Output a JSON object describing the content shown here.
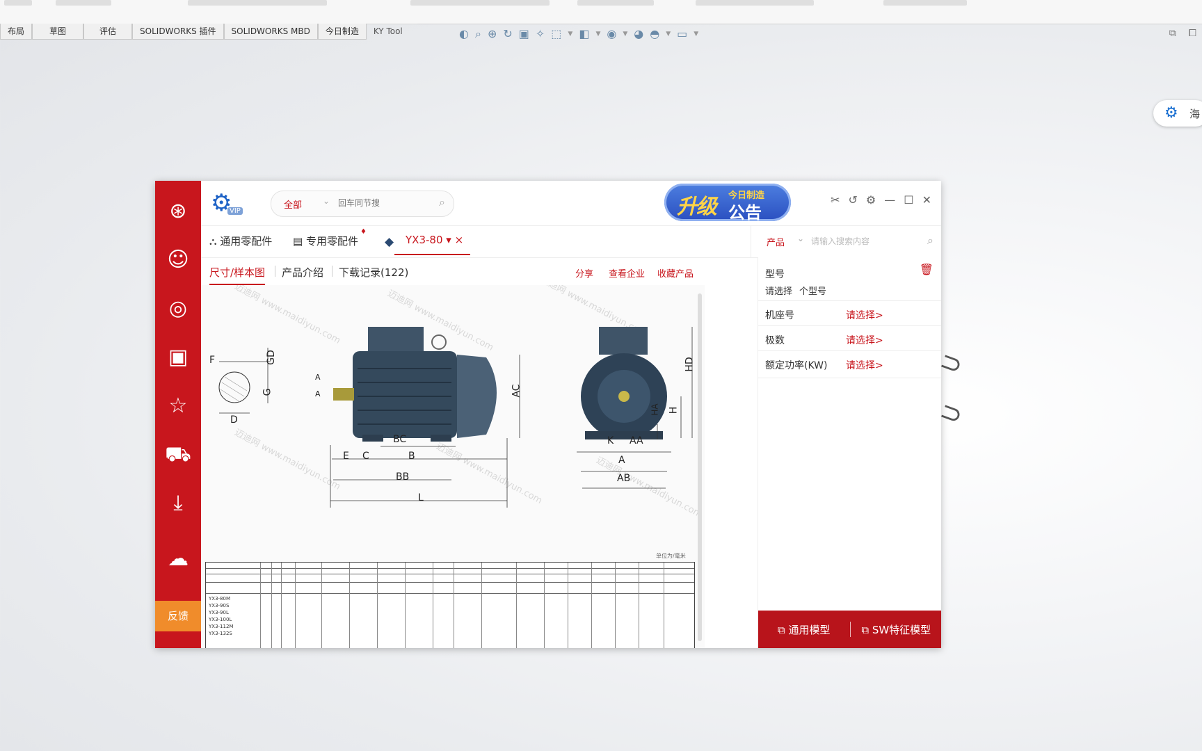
{
  "sw": {
    "tabs": [
      "布局",
      "草图",
      "评估",
      "SOLIDWORKS 插件",
      "SOLIDWORKS MBD",
      "今日制造",
      "KY Tool"
    ]
  },
  "side_pill": {
    "text": "海"
  },
  "app": {
    "header": {
      "vip": "VIP",
      "search_scope": "全部",
      "search_placeholder": "回车同节搜",
      "banner_main": "升级",
      "banner_sub": "今日制造",
      "banner_sub2": "公告"
    },
    "tabs": {
      "general": "通用零配件",
      "special": "专用零配件",
      "current": "YX3-80",
      "current_caret": "▾",
      "close": "×"
    },
    "right_search": {
      "scope": "产品",
      "placeholder": "请输入搜索内容"
    },
    "subtabs": {
      "dims": "尺寸/样本图",
      "intro": "产品介绍",
      "downloads": "下载记录(122)"
    },
    "actions": {
      "share": "分享",
      "company": "查看企业",
      "favorite": "收藏产品"
    },
    "drawing": {
      "labels": [
        "F",
        "GD",
        "G",
        "D",
        "A",
        "A",
        "AC",
        "BC",
        "E",
        "C",
        "B",
        "BB",
        "L",
        "HD",
        "HA",
        "H",
        "K",
        "AA",
        "A",
        "AB"
      ],
      "watermark": "迈迪网 www.maidiyun.com"
    },
    "table": {
      "note": "单位为/毫米",
      "rows": [
        "YX3-80M",
        "YX3-90S",
        "YX3-90L",
        "YX3-100L",
        "YX3-112M",
        "YX3-132S"
      ]
    },
    "right_panel": {
      "model_label": "型号",
      "please_select": "请选择",
      "model_count": "个型号",
      "rows": [
        {
          "key": "机座号",
          "value": "请选择>"
        },
        {
          "key": "极数",
          "value": "请选择>"
        },
        {
          "key": "额定功率(KW)",
          "value": "请选择>"
        }
      ],
      "btn_general": "通用模型",
      "btn_sw": "SW特征模型"
    },
    "rail": {
      "feedback": "反馈"
    }
  },
  "colors": {
    "brand_red": "#c8161d",
    "orange": "#f08c2b",
    "blue": "#1f63c6"
  }
}
